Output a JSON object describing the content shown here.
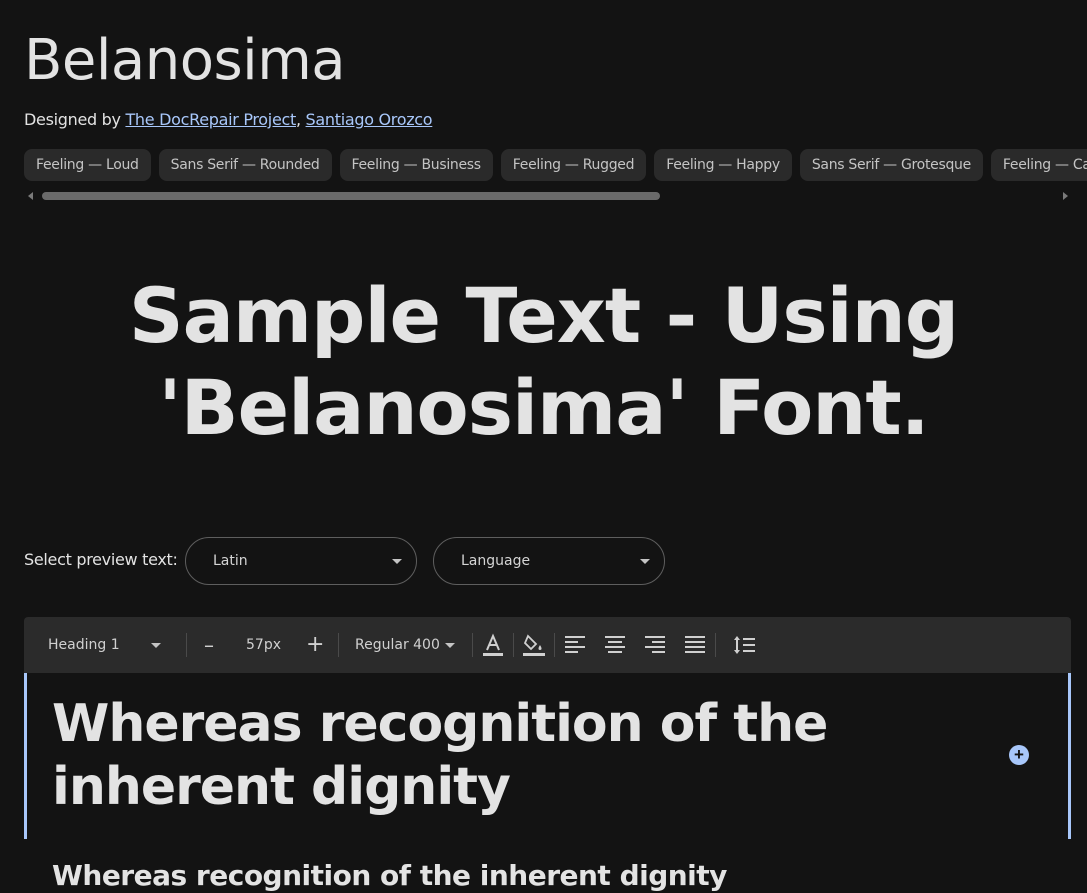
{
  "font": {
    "name": "Belanosima",
    "designed_by_prefix": "Designed by ",
    "designers": [
      "The DocRepair Project",
      "Santiago Orozco"
    ],
    "designer_separator": ", "
  },
  "tags": [
    "Feeling — Loud",
    "Sans Serif — Rounded",
    "Feeling — Business",
    "Feeling — Rugged",
    "Feeling — Happy",
    "Sans Serif — Grotesque",
    "Feeling — Calm"
  ],
  "sample": {
    "line1": "Sample Text - Using",
    "line2": "'Belanosima' Font."
  },
  "preview": {
    "label": "Select preview text:",
    "script_select": "Latin",
    "language_select": "Language"
  },
  "toolbar": {
    "style": "Heading 1",
    "minus": "–",
    "size": "57px",
    "plus": "+",
    "weight": "Regular 400"
  },
  "editor": {
    "text": "Whereas recognition of the inherent dignity",
    "add": "+"
  },
  "subsequent": {
    "text": "Whereas recognition of the inherent dignity"
  },
  "colors": {
    "background": "#131313",
    "link": "#a8c7fa",
    "chip": "#2a2a2a",
    "toolbar": "#2b2b2b",
    "editor_border": "#a8c7fa"
  }
}
